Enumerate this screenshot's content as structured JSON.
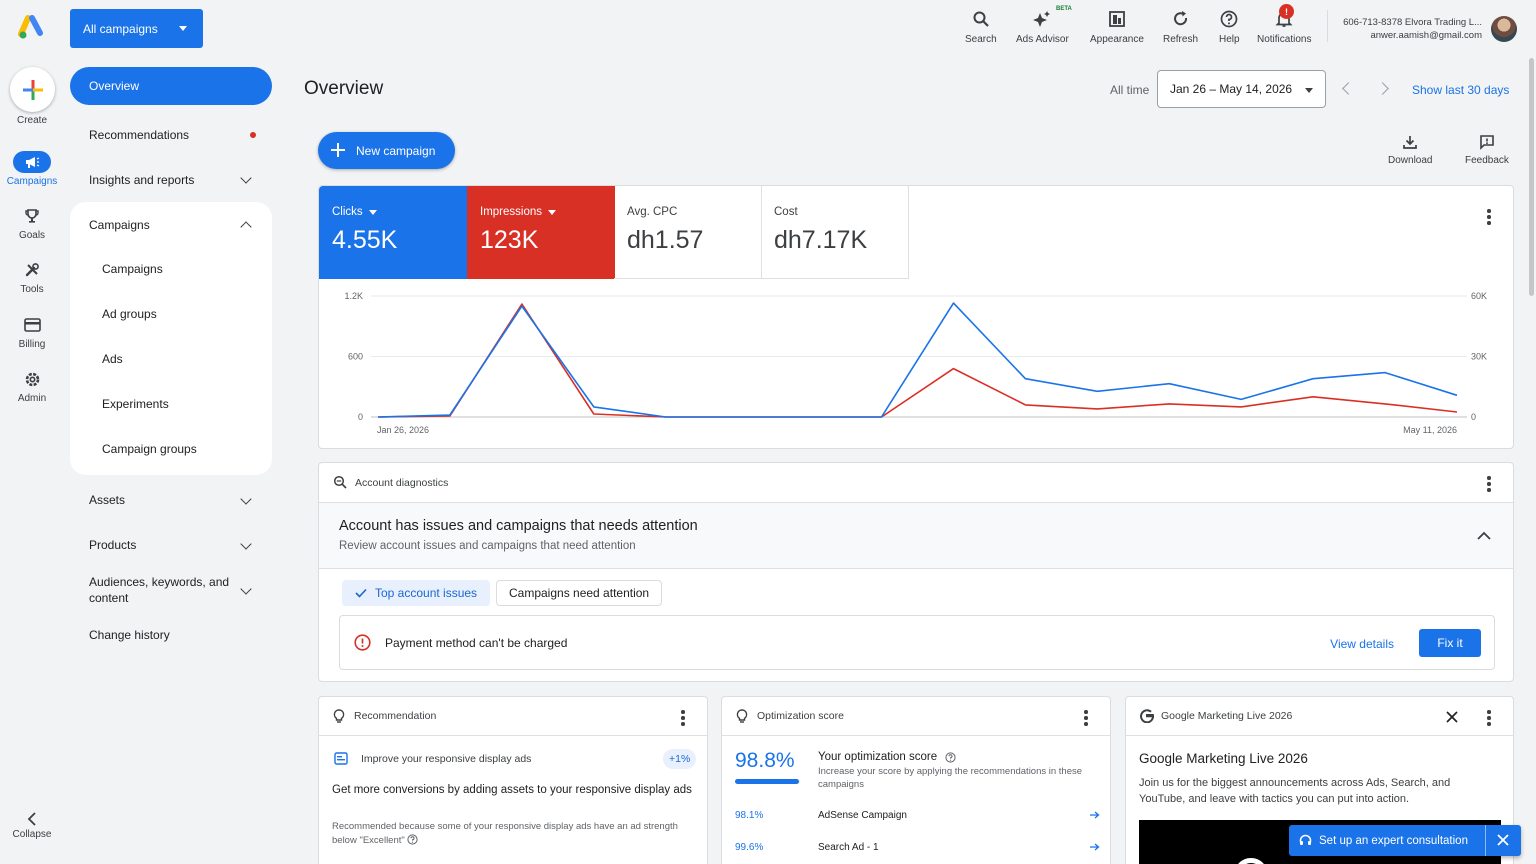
{
  "rail": {
    "create": "Create",
    "items": [
      {
        "label": "Campaigns",
        "icon": "megaphone-icon"
      },
      {
        "label": "Goals",
        "icon": "trophy-icon"
      },
      {
        "label": "Tools",
        "icon": "tools-icon"
      },
      {
        "label": "Billing",
        "icon": "card-icon"
      },
      {
        "label": "Admin",
        "icon": "gear-icon"
      }
    ],
    "collapse": "Collapse"
  },
  "campaign_selector": "All campaigns",
  "sidenav": {
    "overview": "Overview",
    "recommendations": "Recommendations",
    "insights": "Insights and reports",
    "campaigns": "Campaigns",
    "sub": [
      "Campaigns",
      "Ad groups",
      "Ads",
      "Experiments",
      "Campaign groups"
    ],
    "assets": "Assets",
    "products": "Products",
    "audiences": "Audiences, keywords, and content",
    "change_history": "Change history"
  },
  "topbar": {
    "search": "Search",
    "ads_advisor": "Ads Advisor",
    "beta": "BETA",
    "appearance": "Appearance",
    "refresh": "Refresh",
    "help": "Help",
    "notifications": "Notifications",
    "notif_badge": "!",
    "account_line1": "606-713-8378 Elvora Trading L...",
    "account_line2": "anwer.aamish@gmail.com"
  },
  "header": {
    "title": "Overview",
    "all_time": "All time",
    "date_range": "Jan 26 – May 14, 2026",
    "show_last": "Show last 30 days",
    "new_campaign": "New campaign",
    "download": "Download",
    "feedback": "Feedback"
  },
  "metrics": [
    {
      "label": "Clicks",
      "value": "4.55K"
    },
    {
      "label": "Impressions",
      "value": "123K"
    },
    {
      "label": "Avg. CPC",
      "value": "dh1.57"
    },
    {
      "label": "Cost",
      "value": "dh7.17K"
    }
  ],
  "chart_data": {
    "type": "line",
    "x_start_label": "Jan 26, 2026",
    "x_end_label": "May 11, 2026",
    "left_ticks": [
      "0",
      "600",
      "1.2K"
    ],
    "right_ticks": [
      "0",
      "30K",
      "60K"
    ],
    "ylim_left": [
      0,
      1200
    ],
    "ylim_right": [
      0,
      60000
    ],
    "series": [
      {
        "name": "Clicks",
        "axis": "left",
        "color": "#1a73e8",
        "values": [
          0,
          20,
          1100,
          100,
          0,
          0,
          0,
          0,
          1130,
          380,
          255,
          330,
          175,
          380,
          440,
          215
        ]
      },
      {
        "name": "Impressions",
        "axis": "right",
        "color": "#d93025",
        "values": [
          0,
          500,
          56000,
          1500,
          0,
          0,
          0,
          0,
          24000,
          6000,
          4000,
          6500,
          5000,
          10000,
          6500,
          2500
        ]
      }
    ]
  },
  "diagnostics": {
    "title": "Account diagnostics",
    "heading": "Account has issues and campaigns that needs attention",
    "subheading": "Review account issues and campaigns that need attention",
    "chip1": "Top account issues",
    "chip2": "Campaigns need attention",
    "issue": "Payment method can't be charged",
    "view_details": "View details",
    "fix_it": "Fix it"
  },
  "recommendation": {
    "title": "Recommendation",
    "item": "Improve your responsive display ads",
    "badge": "+1%",
    "headline": "Get more conversions by adding assets to your responsive display ads",
    "note": "Recommended because some of your responsive display ads have an ad strength below \"Excellent\""
  },
  "optimization": {
    "title": "Optimization score",
    "score": "98.8%",
    "score_fraction": 0.988,
    "your_score": "Your optimization score",
    "desc": "Increase your score by applying the recommendations in these campaigns",
    "rows": [
      {
        "pct": "98.1%",
        "name": "AdSense Campaign"
      },
      {
        "pct": "99.6%",
        "name": "Search Ad - 1"
      }
    ]
  },
  "gml": {
    "title": "Google Marketing Live 2026",
    "heading": "Google Marketing Live 2026",
    "body": "Join us for the biggest announcements across Ads, Search, and YouTube, and leave with tactics you can put into action."
  },
  "consult": "Set up an expert consultation"
}
